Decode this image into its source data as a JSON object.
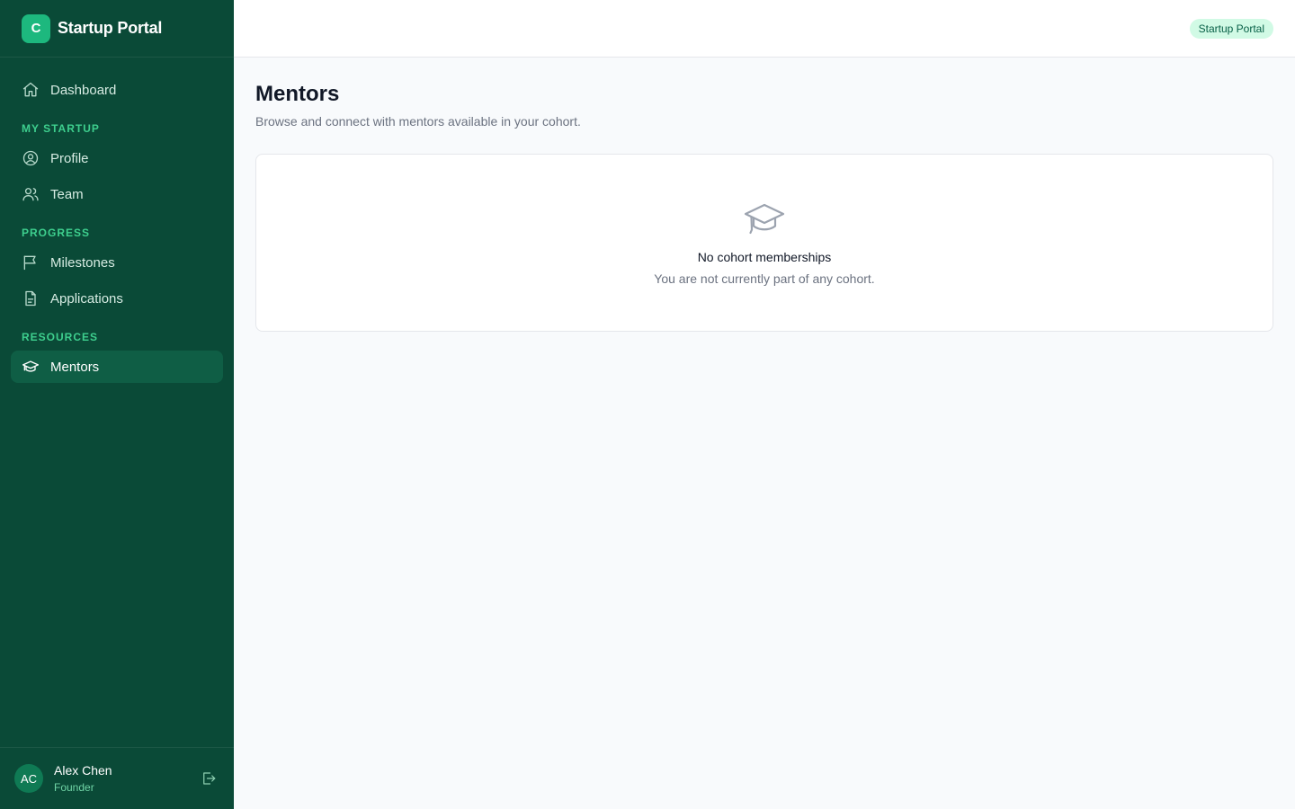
{
  "brand": {
    "logo_letter": "C",
    "name": "Startup Portal"
  },
  "sidebar": {
    "dashboard": {
      "label": "Dashboard",
      "icon": "home-icon"
    },
    "sections": [
      {
        "title": "MY STARTUP",
        "items": [
          {
            "label": "Profile",
            "icon": "user-circle-icon"
          },
          {
            "label": "Team",
            "icon": "users-icon"
          }
        ]
      },
      {
        "title": "PROGRESS",
        "items": [
          {
            "label": "Milestones",
            "icon": "flag-icon"
          },
          {
            "label": "Applications",
            "icon": "document-icon"
          }
        ]
      },
      {
        "title": "RESOURCES",
        "items": [
          {
            "label": "Mentors",
            "icon": "graduation-cap-icon",
            "active": true
          }
        ]
      }
    ]
  },
  "user": {
    "initials": "AC",
    "name": "Alex Chen",
    "role": "Founder"
  },
  "topbar": {
    "badge": "Startup Portal"
  },
  "main": {
    "title": "Mentors",
    "subtitle": "Browse and connect with mentors available in your cohort.",
    "empty_state": {
      "icon": "graduation-cap-icon",
      "title": "No cohort memberships",
      "message": "You are not currently part of any cohort."
    }
  },
  "colors": {
    "sidebar_bg": "#0a4a37",
    "accent": "#1db87e",
    "section_title": "#3ecf8e",
    "badge_bg": "#d1fae5",
    "badge_text": "#065f46"
  }
}
